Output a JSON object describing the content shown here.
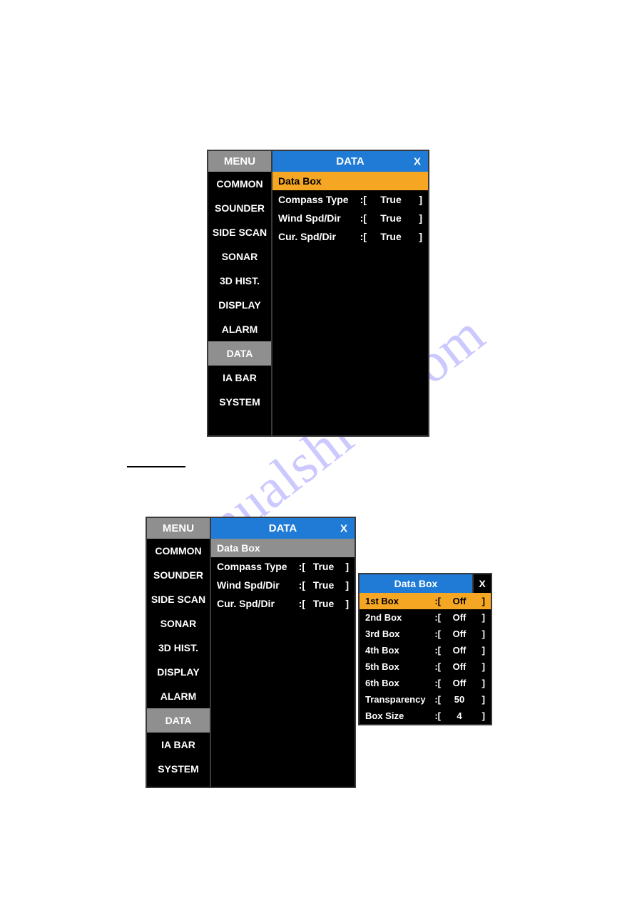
{
  "watermark": "manualshive.com",
  "sidebar_header": "MENU",
  "sidebar_items": [
    "COMMON",
    "SOUNDER",
    "SIDE SCAN",
    "SONAR",
    "3D HIST.",
    "DISPLAY",
    "ALARM",
    "DATA",
    "IA BAR",
    "SYSTEM"
  ],
  "selected_sidebar": "DATA",
  "main_title": "DATA",
  "close_label": "X",
  "bracket_open": ":[",
  "bracket_close": "]",
  "panel1": {
    "header_item": "Data Box",
    "rows": [
      {
        "label": "Compass Type",
        "value": "True"
      },
      {
        "label": "Wind Spd/Dir",
        "value": "True"
      },
      {
        "label": "Cur. Spd/Dir",
        "value": "True"
      }
    ]
  },
  "panel2": {
    "header_item": "Data Box",
    "rows": [
      {
        "label": "Compass Type",
        "value": "True"
      },
      {
        "label": "Wind Spd/Dir",
        "value": "True"
      },
      {
        "label": "Cur. Spd/Dir",
        "value": "True"
      }
    ]
  },
  "popup": {
    "title": "Data Box",
    "close": "X",
    "rows": [
      {
        "label": "1st Box",
        "value": "Off",
        "highlight": true
      },
      {
        "label": "2nd Box",
        "value": "Off"
      },
      {
        "label": "3rd Box",
        "value": "Off"
      },
      {
        "label": "4th Box",
        "value": "Off"
      },
      {
        "label": "5th Box",
        "value": "Off"
      },
      {
        "label": "6th Box",
        "value": "Off"
      },
      {
        "label": "Transparency",
        "value": "50"
      },
      {
        "label": "Box Size",
        "value": "4"
      }
    ]
  }
}
